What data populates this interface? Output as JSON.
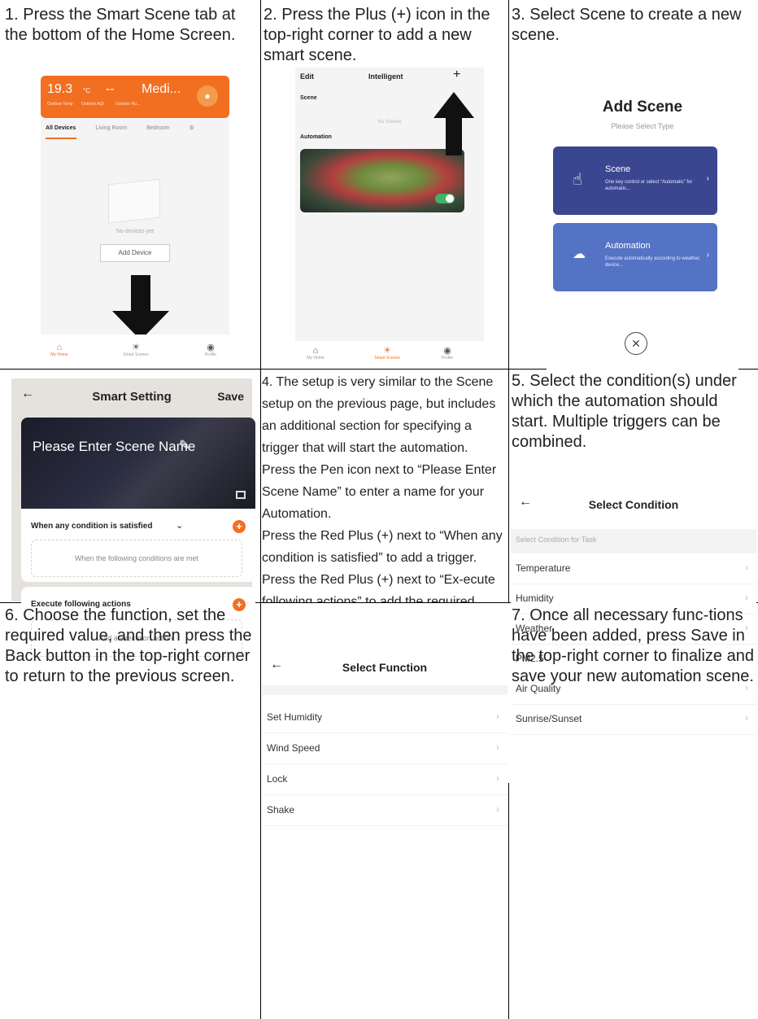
{
  "steps": {
    "s1": "1. Press the Smart Scene tab at the bottom of the Home Screen.",
    "s2": "2. Press the Plus (+) icon in the top-right corner to add a new smart scene.",
    "s3": "3. Select Scene to create a new scene.",
    "s4_p1": "4. The setup is very similar to the Scene setup on the previous page, but includes an additional section for specifying a trigger that will start the automation.",
    "s4_p2": "Press the Pen icon next to “Please Enter Scene Name” to enter a name for your Automation.",
    "s4_p3": "Press the Red Plus (+) next to “When any condition is satisfied” to add a trigger.",
    "s4_p4": "Press the Red Plus (+) next to “Ex-ecute following actions” to add the required action, then select the air conditioner from the list of devices.",
    "s5": "5. Select the condition(s) under which the automation should start. Multiple triggers can be combined.",
    "s6": "6. Choose the function, set the required value, and then press the Back button in the top-right corner to return to the previous screen.",
    "s7": "7. Once all necessary func-tions have been added, press Save in the top-right corner to finalize and save your new automation scene."
  },
  "home": {
    "temp": "19.3",
    "temp_unit": "°C",
    "aqi": "--",
    "hum": "Medi...",
    "temp_label": "Outdoor Temp",
    "aqi_label": "Outdoor AQI",
    "hum_label": "Outdoor Hu...",
    "tabs": [
      "All Devices",
      "Living Room",
      "Bedroom"
    ],
    "no_devices": "No devices yet",
    "add_device": "Add Device",
    "nav": [
      "My Home",
      "Smart Scenes",
      "Profile"
    ]
  },
  "intelligent": {
    "edit": "Edit",
    "title": "Intelligent",
    "scene": "Scene",
    "no_scenes": "No Scenes",
    "automation": "Automation",
    "nav": [
      "My Home",
      "Smart Scenes",
      "Profile"
    ]
  },
  "add_scene": {
    "title": "Add Scene",
    "subtitle": "Please Select Type",
    "scene_name": "Scene",
    "scene_desc": "One key control or select “Automatic” for automatic...",
    "auto_name": "Automation",
    "auto_desc": "Execute automatically according to weather, device..."
  },
  "smart_setting": {
    "title": "Smart Setting",
    "save": "Save",
    "scene_name": "Please Enter Scene Name",
    "condition_label": "When any condition is satisfied",
    "condition_placeholder": "When the following conditions are met",
    "actions_label": "Execute following actions",
    "actions_placeholder": "Add a execution action."
  },
  "select_condition": {
    "title": "Select Condition",
    "section": "Select Condition for Task",
    "items": [
      "Temperature",
      "Humidity",
      "Weather",
      "PM2.5",
      "Air Quality",
      "Sunrise/Sunset"
    ]
  },
  "select_function": {
    "title": "Select Function",
    "items": [
      "Set Humidity",
      "Wind Speed",
      "Lock",
      "Shake"
    ]
  },
  "colors": {
    "orange": "#f26f21",
    "scene_card": "#3b4691",
    "auto_card": "#5573c4",
    "toggle": "#3fb36a"
  }
}
